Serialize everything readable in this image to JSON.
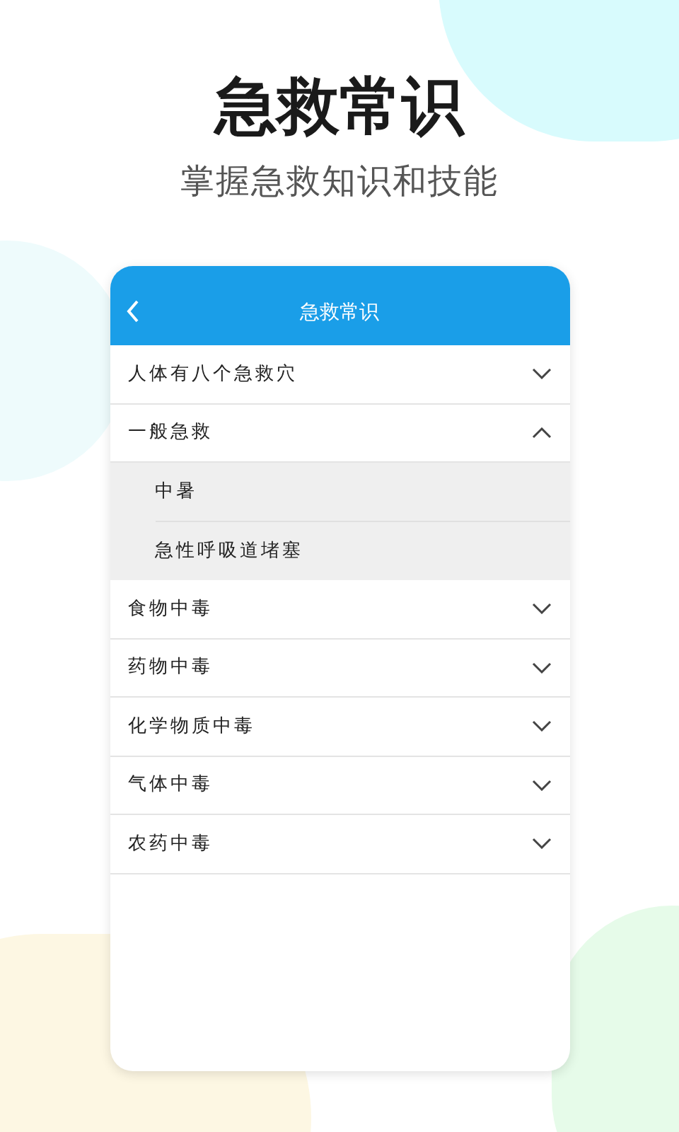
{
  "headline": "急救常识",
  "subtitle": "掌握急救知识和技能",
  "phone": {
    "title": "急救常识",
    "sections": [
      {
        "label": "人体有八个急救穴",
        "expanded": false
      },
      {
        "label": "一般急救",
        "expanded": true,
        "children": [
          {
            "label": "中暑"
          },
          {
            "label": "急性呼吸道堵塞"
          }
        ]
      },
      {
        "label": "食物中毒",
        "expanded": false
      },
      {
        "label": "药物中毒",
        "expanded": false
      },
      {
        "label": "化学物质中毒",
        "expanded": false
      },
      {
        "label": "气体中毒",
        "expanded": false
      },
      {
        "label": "农药中毒",
        "expanded": false
      }
    ]
  }
}
